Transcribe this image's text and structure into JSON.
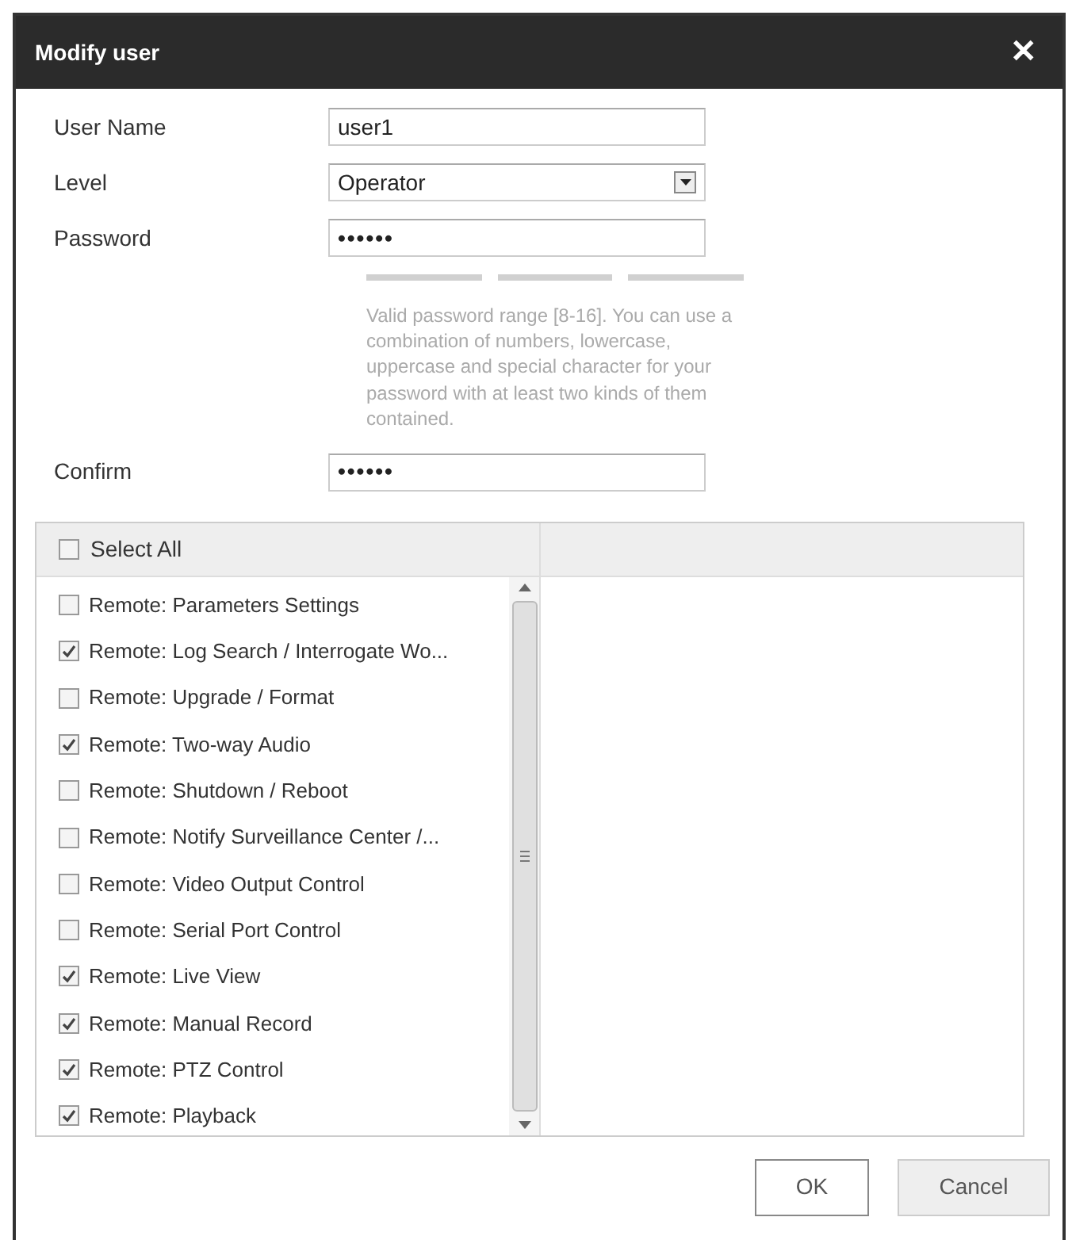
{
  "window": {
    "title": "Modify user",
    "close": "✕"
  },
  "form": [
    {
      "kind": "text",
      "label": "User Name",
      "value": "user1"
    },
    {
      "kind": "select",
      "label": "Level",
      "value": "Operator"
    },
    {
      "kind": "password",
      "label": "Password",
      "value": "••••••",
      "hint": "Valid password range [8-16]. You can use a combination of numbers, lowercase, uppercase and special character for your password with at least two kinds of them contained."
    },
    {
      "kind": "password",
      "label": "Confirm",
      "value": "••••••"
    }
  ],
  "permissions": {
    "select_all": {
      "label": "Select All",
      "checked": false
    },
    "items": [
      {
        "label": "Remote: Parameters Settings",
        "checked": false
      },
      {
        "label": "Remote: Log Search / Interrogate Wo...",
        "checked": true
      },
      {
        "label": "Remote: Upgrade / Format",
        "checked": false
      },
      {
        "label": "Remote: Two-way Audio",
        "checked": true
      },
      {
        "label": "Remote: Shutdown / Reboot",
        "checked": false
      },
      {
        "label": "Remote: Notify Surveillance Center /...",
        "checked": false
      },
      {
        "label": "Remote: Video Output Control",
        "checked": false
      },
      {
        "label": "Remote: Serial Port Control",
        "checked": false
      },
      {
        "label": "Remote: Live View",
        "checked": true
      },
      {
        "label": "Remote: Manual Record",
        "checked": true
      },
      {
        "label": "Remote: PTZ Control",
        "checked": true
      },
      {
        "label": "Remote: Playback",
        "checked": true
      }
    ]
  },
  "buttons": [
    {
      "label": "OK",
      "kind": "primary"
    },
    {
      "label": "Cancel",
      "kind": "secondary"
    }
  ]
}
